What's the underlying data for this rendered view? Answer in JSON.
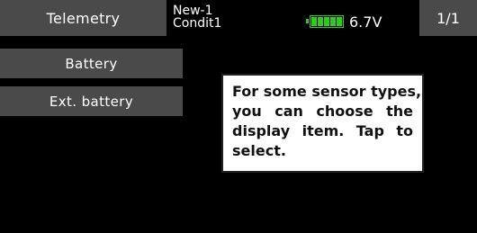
{
  "header": {
    "title": "Telemetry",
    "model_name": "New-1",
    "condition": "Condit1",
    "battery_voltage": "6.7V",
    "battery_level_fraction": 1.0,
    "page": "1/1"
  },
  "menu": {
    "items": [
      {
        "label": "Battery"
      },
      {
        "label": "Ext. battery"
      }
    ]
  },
  "callout": {
    "lines": [
      "For some sensor types,",
      "you can choose the",
      "display item. Tap to",
      "select."
    ]
  },
  "colors": {
    "button_bg": "#4a4a4a",
    "battery_green": "#2ecc1f",
    "background": "#000000"
  },
  "icons": {
    "battery": "battery-icon"
  }
}
